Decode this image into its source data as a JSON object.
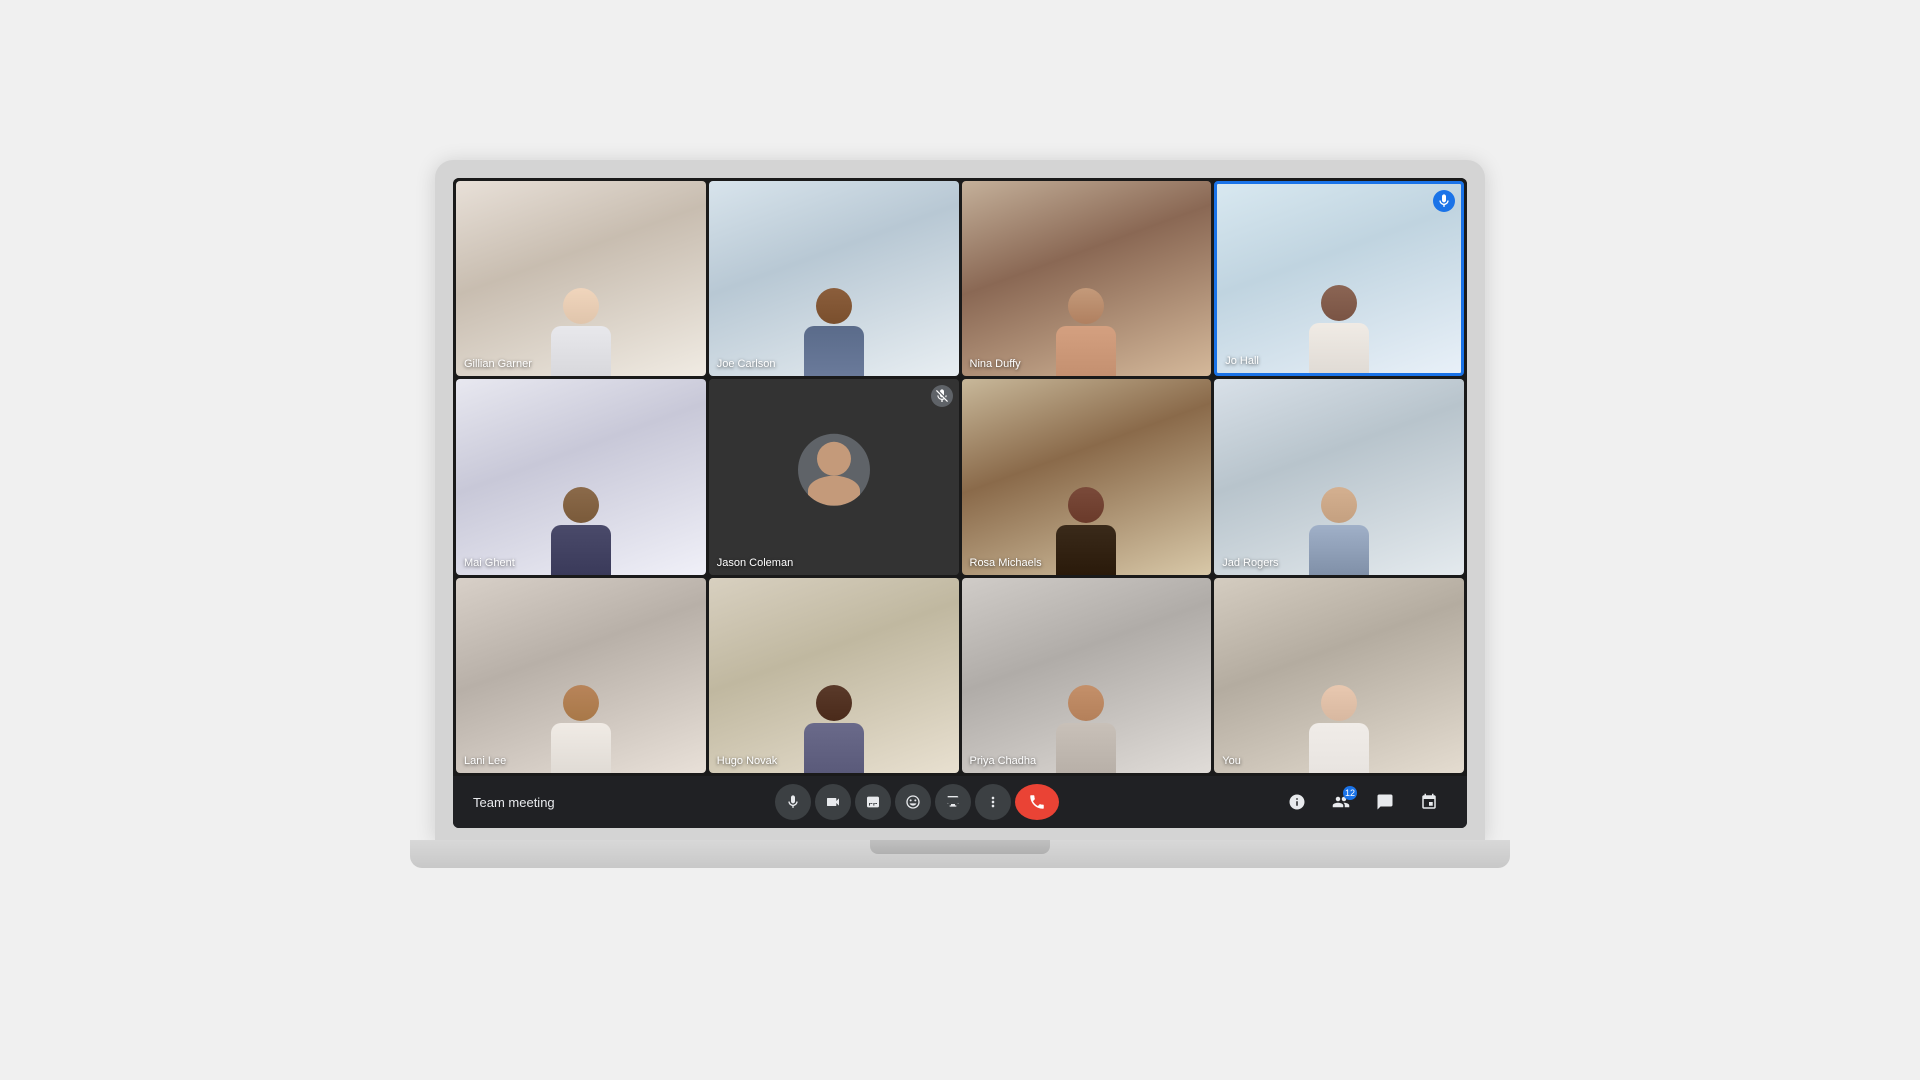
{
  "meeting": {
    "title": "Team meeting",
    "participants_count": 12
  },
  "participants": [
    {
      "id": "gillian",
      "name": "Gillian Garner",
      "row": 1,
      "col": 1,
      "camera_on": true,
      "muted": false,
      "active_speaker": false
    },
    {
      "id": "joe",
      "name": "Joe Carlson",
      "row": 1,
      "col": 2,
      "camera_on": true,
      "muted": false,
      "active_speaker": false
    },
    {
      "id": "nina",
      "name": "Nina Duffy",
      "row": 1,
      "col": 3,
      "camera_on": true,
      "muted": false,
      "active_speaker": false
    },
    {
      "id": "jo",
      "name": "Jo Hall",
      "row": 1,
      "col": 4,
      "camera_on": true,
      "muted": false,
      "active_speaker": true
    },
    {
      "id": "mai",
      "name": "Mai Ghent",
      "row": 2,
      "col": 1,
      "camera_on": true,
      "muted": false,
      "active_speaker": false
    },
    {
      "id": "jason",
      "name": "Jason Coleman",
      "row": 2,
      "col": 2,
      "camera_on": false,
      "muted": true,
      "active_speaker": false
    },
    {
      "id": "rosa",
      "name": "Rosa Michaels",
      "row": 2,
      "col": 3,
      "camera_on": true,
      "muted": false,
      "active_speaker": false
    },
    {
      "id": "jad",
      "name": "Jad Rogers",
      "row": 2,
      "col": 4,
      "camera_on": true,
      "muted": false,
      "active_speaker": false
    },
    {
      "id": "lani",
      "name": "Lani Lee",
      "row": 3,
      "col": 1,
      "camera_on": true,
      "muted": false,
      "active_speaker": false
    },
    {
      "id": "hugo",
      "name": "Hugo Novak",
      "row": 3,
      "col": 2,
      "camera_on": true,
      "muted": false,
      "active_speaker": false
    },
    {
      "id": "priya",
      "name": "Priya Chadha",
      "row": 3,
      "col": 3,
      "camera_on": true,
      "muted": false,
      "active_speaker": false
    },
    {
      "id": "you",
      "name": "You",
      "row": 3,
      "col": 4,
      "camera_on": true,
      "muted": false,
      "active_speaker": false
    }
  ],
  "controls": {
    "mic_label": "Microphone",
    "camera_label": "Camera",
    "captions_label": "Captions",
    "reactions_label": "Reactions",
    "present_label": "Present now",
    "more_label": "More options",
    "end_call_label": "Leave call",
    "info_label": "Meeting details",
    "people_label": "People",
    "chat_label": "Chat",
    "activities_label": "Activities"
  },
  "colors": {
    "background": "#202124",
    "tile_bg": "#2d2d2d",
    "active_border": "#1a73e8",
    "end_call": "#ea4335",
    "control_btn": "#3c4043",
    "text": "#e8eaed"
  }
}
